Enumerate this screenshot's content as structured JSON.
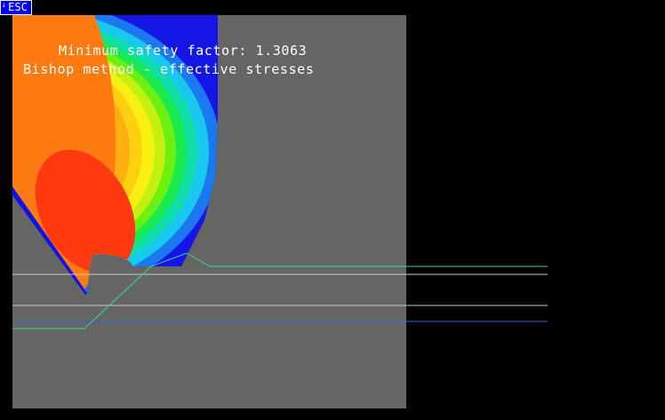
{
  "window": {
    "esc_label": "ESC"
  },
  "result": {
    "line1": "Minimum safety factor: 1.3063",
    "line2": "Bishop method - effective stresses"
  },
  "colors": {
    "background": "#000000",
    "model_fill": "#656563",
    "button": "#0000ff",
    "water_line": "#3bd8a0",
    "boundary_line": "#c8c8c8",
    "blue_line": "#2b6cd6",
    "contour_high": "#ff3a10",
    "contour_low": "#1010e8"
  }
}
